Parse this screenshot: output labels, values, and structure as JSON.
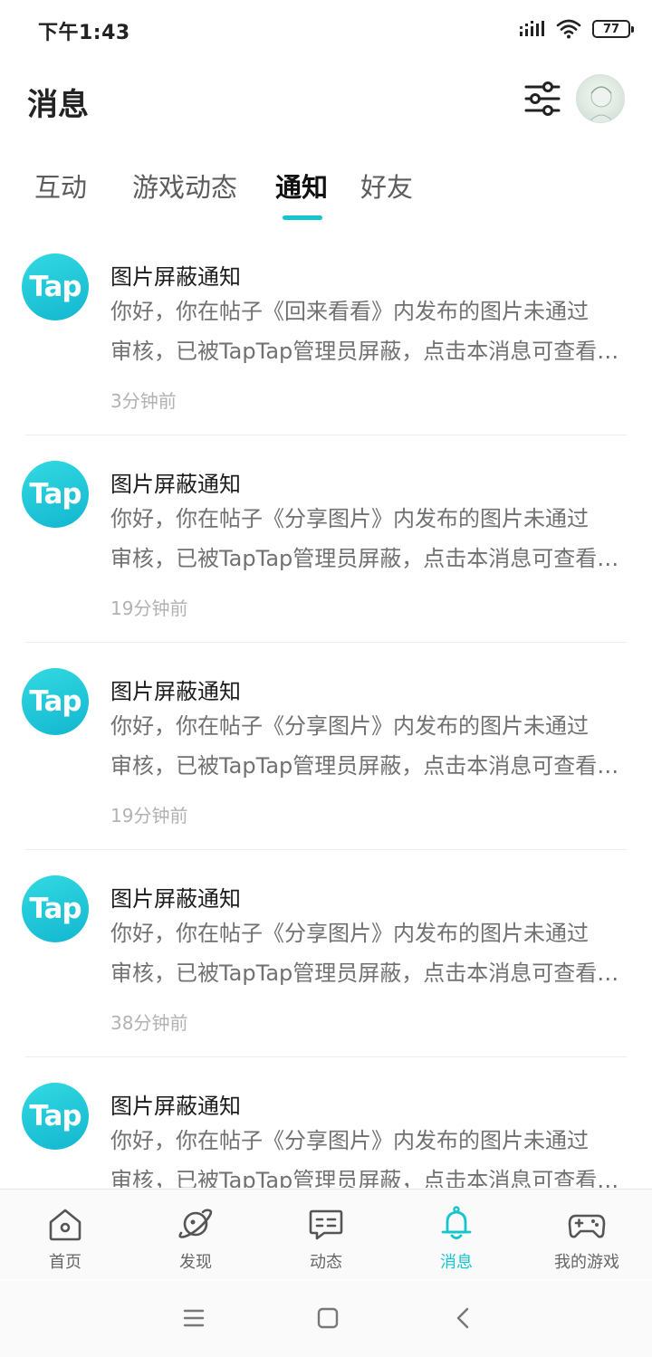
{
  "status_bar": {
    "time": "下午1:43",
    "battery": "77",
    "icons": [
      "signal-icon",
      "wifi-icon",
      "battery-icon"
    ]
  },
  "header": {
    "title": "消息",
    "filter_icon": "filter-sliders-icon",
    "avatar_icon": "user-avatar"
  },
  "tabs": [
    {
      "label": "互动",
      "active": false
    },
    {
      "label": "游戏动态",
      "active": false
    },
    {
      "label": "通知",
      "active": true
    },
    {
      "label": "好友",
      "active": false
    }
  ],
  "colors": {
    "accent": "#15c5ce",
    "tap_gradient_start": "#33d9e1",
    "tap_gradient_end": "#12b7d0",
    "text_primary": "#1d1d1d",
    "text_secondary": "#717171",
    "text_muted": "#b2b2b2"
  },
  "notifications": [
    {
      "avatar_text": "Tap",
      "title": "图片屏蔽通知",
      "line1": "你好，你在帖子《回来看看》内发布的图片未通过",
      "line2": "审核，已被TapTap管理员屏蔽，点击本消息可查看详情",
      "time": "3分钟前"
    },
    {
      "avatar_text": "Tap",
      "title": "图片屏蔽通知",
      "line1": "你好，你在帖子《分享图片》内发布的图片未通过",
      "line2": "审核，已被TapTap管理员屏蔽，点击本消息可查看详情",
      "time": "19分钟前"
    },
    {
      "avatar_text": "Tap",
      "title": "图片屏蔽通知",
      "line1": "你好，你在帖子《分享图片》内发布的图片未通过",
      "line2": "审核，已被TapTap管理员屏蔽，点击本消息可查看详情",
      "time": "19分钟前"
    },
    {
      "avatar_text": "Tap",
      "title": "图片屏蔽通知",
      "line1": "你好，你在帖子《分享图片》内发布的图片未通过",
      "line2": "审核，已被TapTap管理员屏蔽，点击本消息可查看详情",
      "time": "38分钟前"
    },
    {
      "avatar_text": "Tap",
      "title": "图片屏蔽通知",
      "line1": "你好，你在帖子《分享图片》内发布的图片未通过",
      "line2": "审核，已被TapTap管理员屏蔽，点击本消息可查看详情",
      "time": ""
    }
  ],
  "bottom_nav": [
    {
      "label": "首页",
      "icon": "home-icon",
      "active": false
    },
    {
      "label": "发现",
      "icon": "planet-icon",
      "active": false
    },
    {
      "label": "动态",
      "icon": "chat-bubble-icon",
      "active": false
    },
    {
      "label": "消息",
      "icon": "bell-icon",
      "active": true
    },
    {
      "label": "我的游戏",
      "icon": "gamepad-icon",
      "active": false
    }
  ],
  "system_nav": [
    "menu-icon",
    "home-square-icon",
    "back-icon"
  ]
}
